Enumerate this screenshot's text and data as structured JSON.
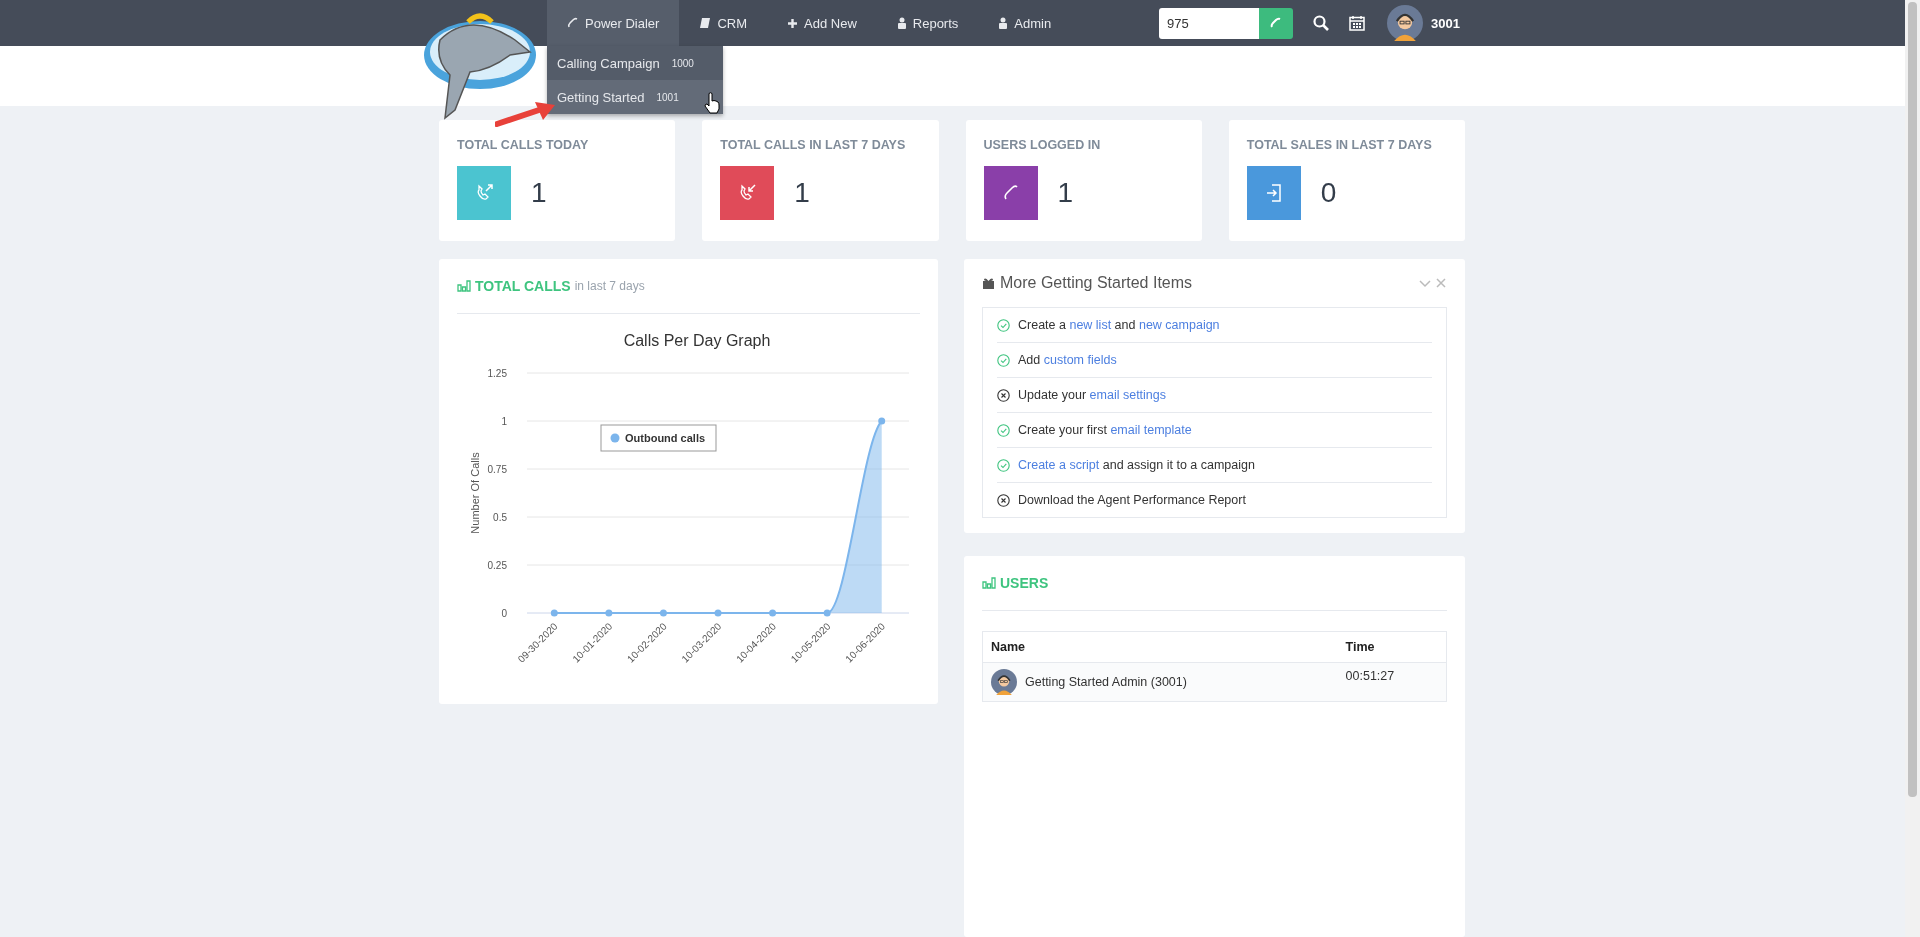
{
  "nav": {
    "items": [
      {
        "label": "Power Dialer",
        "kind": "phone",
        "selected": true
      },
      {
        "label": "CRM",
        "kind": "book",
        "selected": false
      },
      {
        "label": "Add New",
        "kind": "plus",
        "selected": false
      },
      {
        "label": "Reports",
        "kind": "user",
        "selected": false
      },
      {
        "label": "Admin",
        "kind": "user",
        "selected": false
      }
    ],
    "dropdown": [
      {
        "label": "Calling Campaign",
        "count": "1000",
        "selected": false
      },
      {
        "label": "Getting Started",
        "count": "1001",
        "selected": true
      }
    ],
    "dial_field": {
      "value": "975"
    },
    "user": {
      "name": "3001"
    }
  },
  "stats": [
    {
      "title": "TOTAL CALLS TODAY",
      "value": "1",
      "color": "#4bc4d0",
      "kind": "outgoing"
    },
    {
      "title": "TOTAL CALLS IN LAST 7 DAYS",
      "value": "1",
      "color": "#e04b59",
      "kind": "incoming"
    },
    {
      "title": "USERS LOGGED IN",
      "value": "1",
      "color": "#8a3fa9",
      "kind": "phone"
    },
    {
      "title": "TOTAL SALES IN LAST 7 DAYS",
      "value": "0",
      "color": "#4a98dc",
      "kind": "signin"
    }
  ],
  "total_calls": {
    "title": "TOTAL CALLS",
    "subtitle": "in last 7 days",
    "chart_data": {
      "type": "area",
      "title": "Calls Per Day Graph",
      "ylabel": "Number Of Calls",
      "categories": [
        "09-30-2020",
        "10-01-2020",
        "10-02-2020",
        "10-03-2020",
        "10-04-2020",
        "10-05-2020",
        "10-06-2020"
      ],
      "ylim": [
        0,
        1.25
      ],
      "grid": true,
      "yticks": [
        0,
        0.25,
        0.5,
        0.75,
        1,
        1.25
      ],
      "series": [
        {
          "name": "Outbound calls",
          "color": "#7cb5ec",
          "values": [
            0,
            0,
            0,
            0,
            0,
            0,
            1
          ]
        }
      ]
    }
  },
  "getting_started": {
    "title": "More Getting Started Items",
    "items": [
      {
        "done": true,
        "parts": [
          {
            "kind": "text",
            "text": "Create a"
          },
          {
            "kind": "link",
            "text": "new list"
          },
          {
            "kind": "text",
            "text": "and"
          },
          {
            "kind": "link",
            "text": "new campaign"
          }
        ]
      },
      {
        "done": true,
        "parts": [
          {
            "kind": "text",
            "text": "Add"
          },
          {
            "kind": "link",
            "text": "custom fields"
          }
        ]
      },
      {
        "done": false,
        "parts": [
          {
            "kind": "text",
            "text": "Update your"
          },
          {
            "kind": "link",
            "text": "email settings"
          }
        ]
      },
      {
        "done": true,
        "parts": [
          {
            "kind": "text",
            "text": "Create your first"
          },
          {
            "kind": "link",
            "text": "email template"
          }
        ]
      },
      {
        "done": true,
        "parts": [
          {
            "kind": "link",
            "text": "Create a script"
          },
          {
            "kind": "text",
            "text": "and assign it to a campaign"
          }
        ]
      },
      {
        "done": false,
        "parts": [
          {
            "kind": "text",
            "text": "Download the Agent Performance Report"
          }
        ]
      }
    ]
  },
  "users": {
    "title": "USERS",
    "columns": [
      "Name",
      "Time"
    ],
    "rows": [
      {
        "name": "Getting Started Admin (3001)",
        "time": "00:51:27"
      }
    ]
  }
}
